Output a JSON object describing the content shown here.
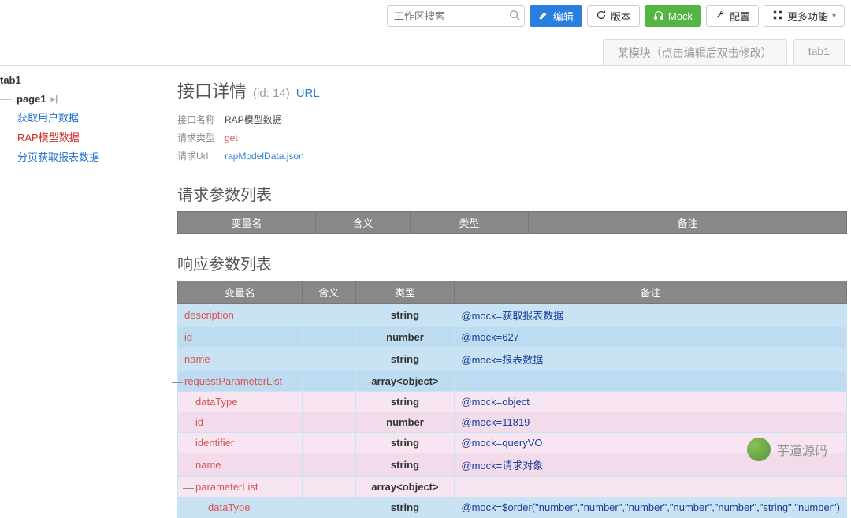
{
  "toolbar": {
    "search_placeholder": "工作区搜索",
    "edit": "编辑",
    "version": "版本",
    "mock": "Mock",
    "config": "配置",
    "more": "更多功能"
  },
  "tabs": {
    "module_placeholder": "某模块（点击编辑后双击修改）",
    "tab1": "tab1"
  },
  "sidebar": {
    "tab_label": "tab1",
    "page_label": "page1",
    "links": [
      {
        "text": "获取用户数据",
        "active": false
      },
      {
        "text": "RAP模型数据",
        "active": true
      },
      {
        "text": "分页获取报表数据",
        "active": false
      }
    ]
  },
  "detail": {
    "title": "接口详情",
    "id_text": "(id: 14)",
    "url_label": "URL",
    "name_label": "接口名称",
    "name_value": "RAP模型数据",
    "reqtype_label": "请求类型",
    "reqtype_value": "get",
    "requrl_label": "请求Url",
    "requrl_value": "rapModelData.json"
  },
  "sections": {
    "request_title": "请求参数列表",
    "response_title": "响应参数列表"
  },
  "headers": {
    "var": "变量名",
    "meaning": "含义",
    "type": "类型",
    "remark": "备注"
  },
  "response_rows": [
    {
      "name": "description",
      "type": "string",
      "remark": "@mock=获取报表数据",
      "cls": "row-blue",
      "indent": 0
    },
    {
      "name": "id",
      "type": "number",
      "remark": "@mock=627",
      "cls": "row-blue-alt",
      "indent": 0
    },
    {
      "name": "name",
      "type": "string",
      "remark": "@mock=报表数据",
      "cls": "row-blue",
      "indent": 0
    },
    {
      "name": "requestParameterList",
      "type": "array<object>",
      "remark": "",
      "cls": "row-blue-alt",
      "indent": 0,
      "toggle": true
    },
    {
      "name": "dataType",
      "type": "string",
      "remark": "@mock=object",
      "cls": "row-pink",
      "indent": 1
    },
    {
      "name": "id",
      "type": "number",
      "remark": "@mock=11819",
      "cls": "row-pink-alt",
      "indent": 1
    },
    {
      "name": "identifier",
      "type": "string",
      "remark": "@mock=queryVO",
      "cls": "row-pink",
      "indent": 1
    },
    {
      "name": "name",
      "type": "string",
      "remark": "@mock=请求对象",
      "cls": "row-pink-alt",
      "indent": 1
    },
    {
      "name": "parameterList",
      "type": "array<object>",
      "remark": "",
      "cls": "row-pink",
      "indent": 1,
      "toggle": true
    },
    {
      "name": "dataType",
      "type": "string",
      "remark": "@mock=$order(\"number\",\"number\",\"number\",\"number\",\"number\",\"string\",\"number\")",
      "cls": "row-blue",
      "indent": 2
    }
  ],
  "watermark": {
    "text": "芋道源码"
  }
}
